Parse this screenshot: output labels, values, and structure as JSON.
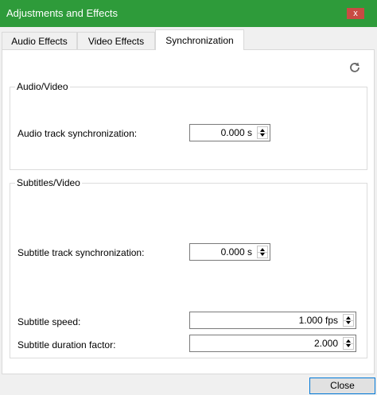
{
  "window": {
    "title": "Adjustments and Effects",
    "close_glyph": "x",
    "accent_color": "#2e9b3a"
  },
  "tabs": [
    {
      "label": "Audio Effects"
    },
    {
      "label": "Video Effects"
    },
    {
      "label": "Synchronization",
      "active": true
    }
  ],
  "toolbar": {
    "reset_icon": "refresh-icon"
  },
  "audio_video": {
    "title": "Audio/Video",
    "audio_sync_label": "Audio track synchronization:",
    "audio_sync_value": "0.000 s"
  },
  "subtitles_video": {
    "title": "Subtitles/Video",
    "subtitle_sync_label": "Subtitle track synchronization:",
    "subtitle_sync_value": "0.000 s",
    "subtitle_speed_label": "Subtitle speed:",
    "subtitle_speed_value": "1.000 fps",
    "subtitle_duration_label": "Subtitle duration factor:",
    "subtitle_duration_value": "2.000"
  },
  "footer": {
    "close_label": "Close"
  }
}
